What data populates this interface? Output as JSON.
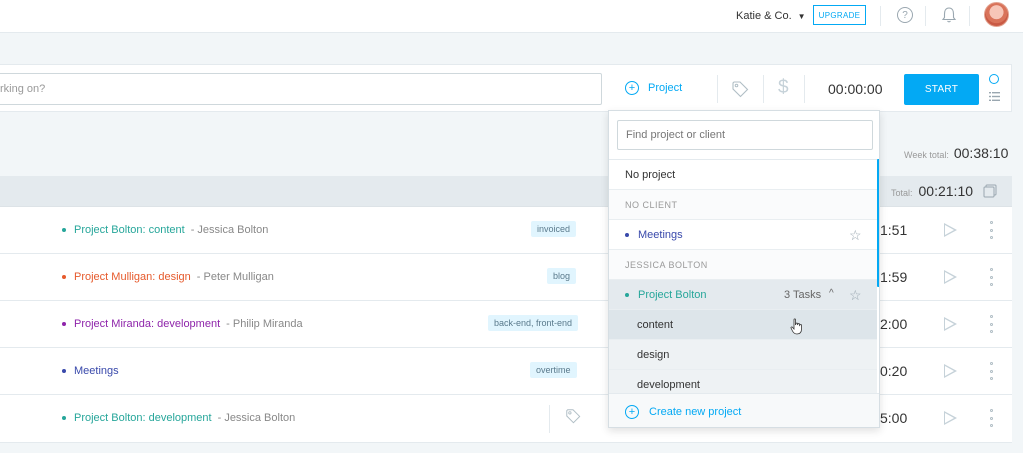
{
  "topbar": {
    "workspace": "Katie & Co.",
    "upgrade": "UPGRADE",
    "help_glyph": "?"
  },
  "timer": {
    "description_placeholder": "rking on?",
    "project_label": "Project",
    "duration": "00:00:00",
    "start_label": "START",
    "dollar_glyph": "$"
  },
  "week": {
    "label": "Week total:",
    "value": "00:38:10"
  },
  "day": {
    "label": "Total:",
    "value": "00:21:10"
  },
  "entries": [
    {
      "project": "Project Bolton: content",
      "client": "- Jessica Bolton",
      "color": "#26a69a",
      "tag": "invoiced",
      "duration": "1:51"
    },
    {
      "project": "Project Mulligan: design",
      "client": "- Peter Mulligan",
      "color": "#e65a2c",
      "tag": "blog",
      "duration": "1:59"
    },
    {
      "project": "Project Miranda: development",
      "client": "- Philip Miranda",
      "color": "#8e24aa",
      "tag": "back-end, front-end",
      "duration": "2:00"
    },
    {
      "project": "Meetings",
      "client": "",
      "color": "#3949ab",
      "tag": "overtime",
      "duration": "0:20"
    },
    {
      "project": "Project Bolton: development",
      "client": "- Jessica Bolton",
      "color": "#26a69a",
      "tag": "",
      "duration": "5:00"
    }
  ],
  "dropdown": {
    "search_placeholder": "Find project or client",
    "no_project": "No project",
    "group_no_client": "NO CLIENT",
    "meetings": "Meetings",
    "group_jessica": "JESSICA BOLTON",
    "project_bolton": "Project Bolton",
    "tasks_count": "3 Tasks",
    "chevron": "^",
    "star": "☆",
    "tasks": [
      "content",
      "design",
      "development"
    ],
    "create": "Create new project"
  },
  "colors": {
    "accent": "#03a9f4",
    "bolton": "#26a69a",
    "meetings": "#3949ab"
  }
}
